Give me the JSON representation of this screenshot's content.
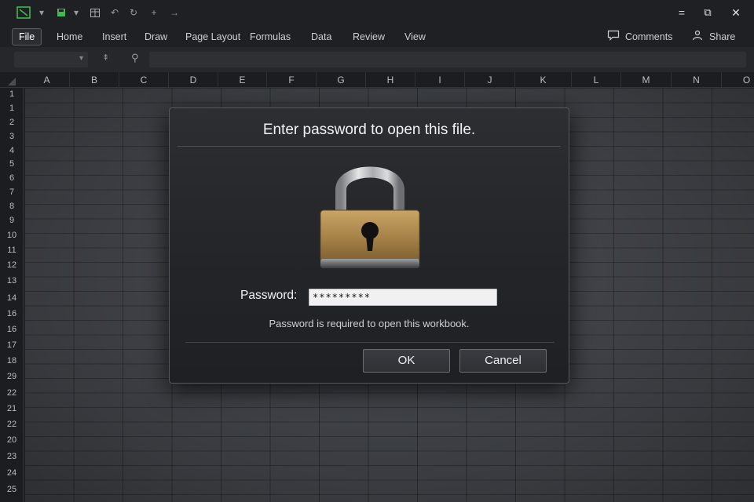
{
  "titlebar": {
    "quick_access_icons": [
      "excel-logo-icon",
      "save-icon",
      "dropdown-icon",
      "table-icon",
      "undo-icon",
      "redo-icon",
      "add-icon",
      "forward-icon"
    ],
    "window_controls": {
      "minimize": "=",
      "restore": "⧉",
      "close": "✕"
    }
  },
  "ribbon": {
    "tabs": [
      {
        "label": "File",
        "active": true
      },
      {
        "label": "Home"
      },
      {
        "label": "Insert"
      },
      {
        "label": "Draw"
      },
      {
        "label": "Page Layout"
      },
      {
        "label": "Formulas"
      },
      {
        "label": "Data"
      },
      {
        "label": "Review"
      },
      {
        "label": "View"
      }
    ],
    "comments_label": "Comments",
    "share_label": "Share"
  },
  "sheet": {
    "columns": [
      "A",
      "B",
      "C",
      "D",
      "E",
      "F",
      "G",
      "H",
      "I",
      "J",
      "K",
      "L",
      "M",
      "N",
      "O"
    ],
    "rows": [
      "1",
      "1",
      "2",
      "3",
      "4",
      "5",
      "6",
      "7",
      "8",
      "9",
      "10",
      "11",
      "12",
      "13",
      "14",
      "16",
      "16",
      "17",
      "18",
      "29",
      "22",
      "21",
      "22",
      "20",
      "23",
      "24",
      "25"
    ]
  },
  "dialog": {
    "title": "Enter password to open this file.",
    "password_label": "Password:",
    "password_value": "*********",
    "hint": "Password is required to open this workbook.",
    "ok_label": "OK",
    "cancel_label": "Cancel"
  },
  "colors": {
    "accent_green": "#3fb950",
    "lock_gold": "#b08a4a",
    "lock_silver": "#c8c8c8"
  }
}
